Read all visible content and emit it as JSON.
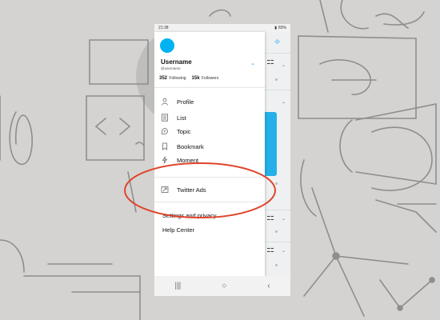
{
  "status_bar": {
    "time": "21:38",
    "battery": "83%"
  },
  "profile": {
    "username": "Username",
    "handle": "@username",
    "following_count": "352",
    "following_label": "Following",
    "followers_count": "15k",
    "followers_label": "Followers"
  },
  "menu": [
    {
      "label": "Profile",
      "icon": "person-icon"
    },
    {
      "label": "List",
      "icon": "list-icon"
    },
    {
      "label": "Topic",
      "icon": "topic-icon"
    },
    {
      "label": "Bookmark",
      "icon": "bookmark-icon"
    },
    {
      "label": "Moment",
      "icon": "lightning-icon"
    }
  ],
  "ads_item": {
    "label": "Twitter Ads",
    "icon": "external-arrow-icon"
  },
  "footer_links": {
    "settings": "Settings and privacy",
    "help": "Help Center"
  },
  "bottom_bar": {
    "left_icon": "lightbulb-icon",
    "right_icon": "qr-code-icon",
    "behind_icon": "mail-icon"
  },
  "nav": {
    "recent": "|||",
    "home": "○",
    "back": "‹"
  },
  "colors": {
    "accent": "#1da1f2",
    "avatar": "#00b2f2",
    "highlight": "#e0452b",
    "background": "#d4d3d1"
  }
}
